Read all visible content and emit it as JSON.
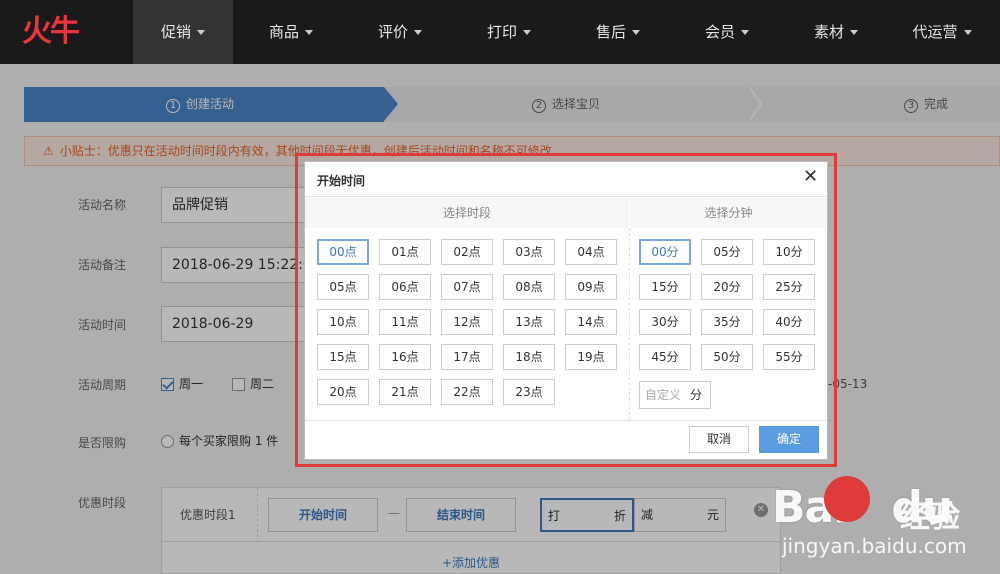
{
  "logo": {
    "text": "火牛"
  },
  "nav": [
    {
      "label": "促销"
    },
    {
      "label": "商品"
    },
    {
      "label": "评价"
    },
    {
      "label": "打印"
    },
    {
      "label": "售后"
    },
    {
      "label": "会员"
    },
    {
      "label": "素材"
    },
    {
      "label": "代运营"
    }
  ],
  "steps": [
    {
      "num": "1",
      "label": "创建活动"
    },
    {
      "num": "2",
      "label": "选择宝贝"
    },
    {
      "num": "3",
      "label": "完成"
    }
  ],
  "tip": "小贴士：优惠只在活动时间时段内有效，其他时间段无优惠，创建后活动时间和名称不可修改",
  "form": {
    "name_label": "活动名称",
    "name_value": "品牌促销",
    "note_label": "活动备注",
    "note_value": "2018-06-29 15:22:0",
    "time_label": "活动时间",
    "time_value": "2018-06-29",
    "cycle_label": "活动周期",
    "cycle_mon": "周一",
    "cycle_tue": "周二",
    "cycle_date_tail": "-05-13",
    "limit_label": "是否限购",
    "limit_option": "每个买家限购 1 件",
    "period_label": "优惠时段",
    "period_row_label": "优惠时段1",
    "start_btn": "开始时间",
    "dash": "—",
    "end_btn": "结束时间",
    "discount_prefix": "打",
    "discount_suffix": "折",
    "minus_prefix": "减",
    "minus_suffix": "元",
    "add_link": "+添加优惠"
  },
  "dialog": {
    "title": "开始时间",
    "close": "✕",
    "hour_header": "选择时段",
    "minute_header": "选择分钟",
    "hours": [
      "00点",
      "01点",
      "02点",
      "03点",
      "04点",
      "05点",
      "06点",
      "07点",
      "08点",
      "09点",
      "10点",
      "11点",
      "12点",
      "13点",
      "14点",
      "15点",
      "16点",
      "17点",
      "18点",
      "19点",
      "20点",
      "21点",
      "22点",
      "23点"
    ],
    "minutes": [
      "00分",
      "05分",
      "10分",
      "15分",
      "20分",
      "25分",
      "30分",
      "35分",
      "40分",
      "45分",
      "50分",
      "55分"
    ],
    "custom_placeholder": "自定义",
    "custom_unit": "分",
    "cancel": "取消",
    "ok": "确定"
  },
  "watermark": {
    "main": "Bai",
    "main2": "du",
    "cn": "经验",
    "url": "jingyan.baidu.com"
  }
}
